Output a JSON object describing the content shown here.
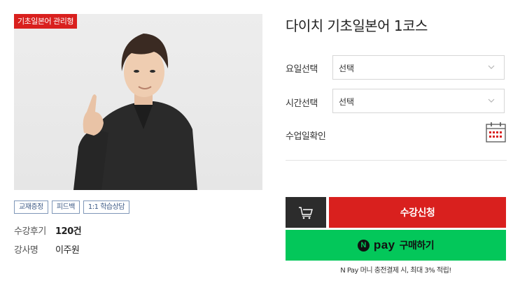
{
  "product": {
    "badge": "기초일본어 관리형",
    "title": "다이치 기초일본어 1코스",
    "tags": [
      "교재증정",
      "피드백",
      "1:1 학습상담"
    ],
    "reviews_label": "수강후기",
    "reviews_value": "120건",
    "teacher_label": "강사명",
    "teacher_value": "이주원"
  },
  "options": {
    "day_label": "요일선택",
    "day_value": "선택",
    "time_label": "시간선택",
    "time_value": "선택",
    "date_label": "수업일확인"
  },
  "actions": {
    "apply_label": "수강신청",
    "npay_n": "N",
    "npay_pay": "pay",
    "npay_buy": "구매하기",
    "npay_note": "N Pay 머니 충전결제 시, 최대 3% 적립!"
  },
  "colors": {
    "accent_red": "#d9201e",
    "npay_green": "#03c75a",
    "cart_dark": "#2c2c2c",
    "tag_blue": "#3d5a86"
  },
  "icons": {
    "cart": "cart-icon",
    "calendar": "calendar-icon",
    "chevron": "chevron-down-icon"
  }
}
